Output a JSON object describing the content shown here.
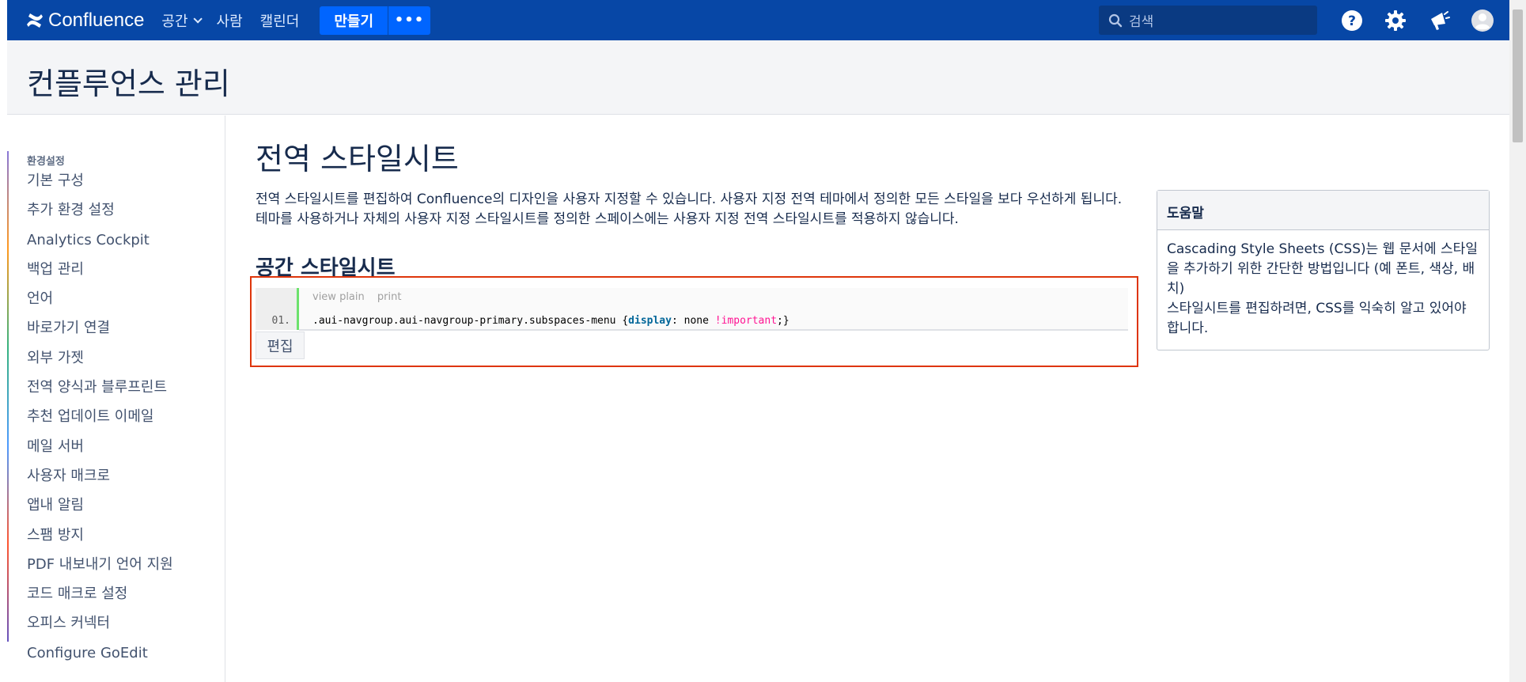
{
  "topnav": {
    "brand": "Confluence",
    "items": [
      {
        "label": "공간",
        "has_dropdown": true
      },
      {
        "label": "사람",
        "has_dropdown": false
      },
      {
        "label": "캘린더",
        "has_dropdown": false
      }
    ],
    "create_label": "만들기",
    "more_label": "•••",
    "search_placeholder": "검색",
    "icons": [
      "help-icon",
      "gear-icon",
      "notification-megaphone-icon",
      "avatar-icon"
    ],
    "color_bg": "#0747a6",
    "color_create": "#0065ff"
  },
  "header": {
    "title": "컨플루언스 관리"
  },
  "sidebar": {
    "section_title": "환경설정",
    "items": [
      {
        "label": "기본 구성"
      },
      {
        "label": "추가 환경 설정"
      },
      {
        "label": "Analytics Cockpit"
      },
      {
        "label": "백업 관리"
      },
      {
        "label": "언어"
      },
      {
        "label": "바로가기 연결"
      },
      {
        "label": "외부 가젯"
      },
      {
        "label": "전역 양식과 블루프린트"
      },
      {
        "label": "추천 업데이트 이메일"
      },
      {
        "label": "메일 서버"
      },
      {
        "label": "사용자 매크로"
      },
      {
        "label": "앱내 알림"
      },
      {
        "label": "스팸 방지"
      },
      {
        "label": "PDF 내보내기 언어 지원"
      },
      {
        "label": "코드 매크로 설정"
      },
      {
        "label": "오피스 커넥터"
      },
      {
        "label": "Configure GoEdit"
      }
    ]
  },
  "main": {
    "title": "전역 스타일시트",
    "desc_line1": "전역 스타일시트를 편집하여 Confluence의 디자인을 사용자 지정할 수 있습니다. 사용자 지정 전역 테마에서 정의한 모든 스타일을 보다 우선하게 됩니다.",
    "desc_line2": "테마를 사용하거나 자체의 사용자 지정 스타일시트를 정의한 스페이스에는 사용자 지정 전역 스타일시트를 적용하지 않습니다.",
    "subtitle": "공간 스타일시트",
    "code": {
      "toolbar_view_plain": "view plain",
      "toolbar_print": "print",
      "line_number": "01.",
      "selector": ".aui-navgroup.aui-navgroup-primary.subspaces-menu ",
      "open_brace": "{",
      "property": "display",
      "colon_value": ": none ",
      "important": "!important",
      "close": ";}"
    },
    "edit_label": "편집",
    "highlight_color": "#de350b"
  },
  "help": {
    "title": "도움말",
    "line1": "Cascading Style Sheets (CSS)는 웹 문서에 스타일을 추가하기 위한 간단한 방법입니다 (예 폰트, 색상, 배치)",
    "line2": "스타일시트를 편집하려면, CSS를 익숙히 알고 있어야 합니다."
  }
}
